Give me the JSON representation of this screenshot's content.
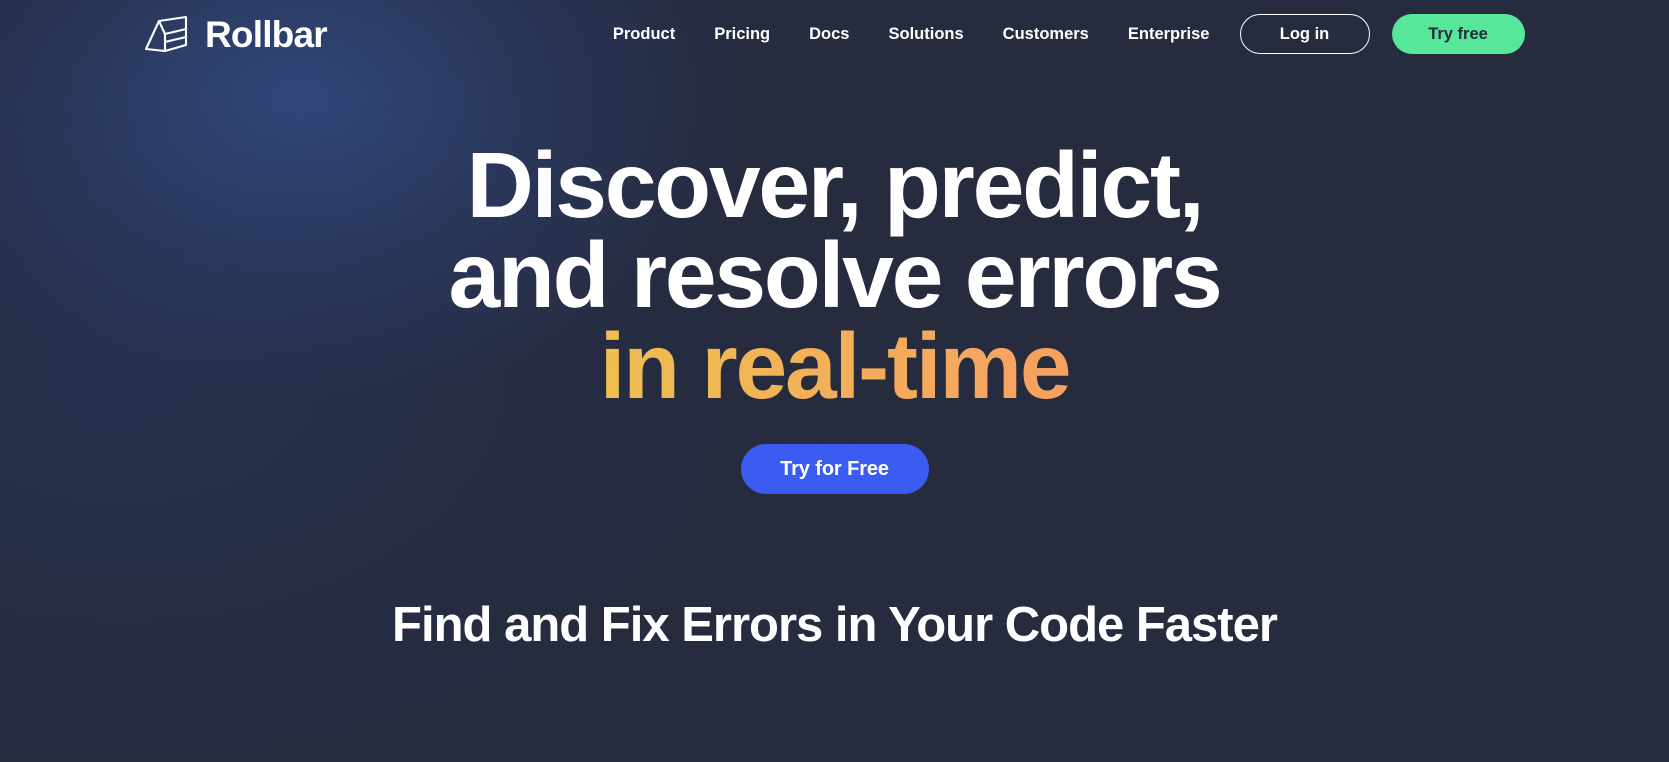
{
  "header": {
    "brand": {
      "name": "Rollbar",
      "icon": "rollbar-cube-logo-icon"
    },
    "nav": [
      {
        "label": "Product"
      },
      {
        "label": "Pricing"
      },
      {
        "label": "Docs"
      },
      {
        "label": "Solutions"
      },
      {
        "label": "Customers"
      },
      {
        "label": "Enterprise"
      }
    ],
    "login_label": "Log in",
    "try_free_label": "Try free"
  },
  "hero": {
    "line1": "Discover, predict,",
    "line2": "and resolve errors",
    "line3_gradient": "in real-time",
    "cta_label": "Try for Free"
  },
  "section": {
    "heading": "Find and Fix Errors in Your Code Faster"
  },
  "colors": {
    "background": "#262b3e",
    "glow_blue": "#38589e",
    "accent_green": "#56e79b",
    "accent_blue": "#3a5cf0",
    "gradient_start": "#e3e02d",
    "gradient_mid": "#eec04f",
    "gradient_end": "#ff8a5b",
    "text_white": "#ffffff"
  }
}
